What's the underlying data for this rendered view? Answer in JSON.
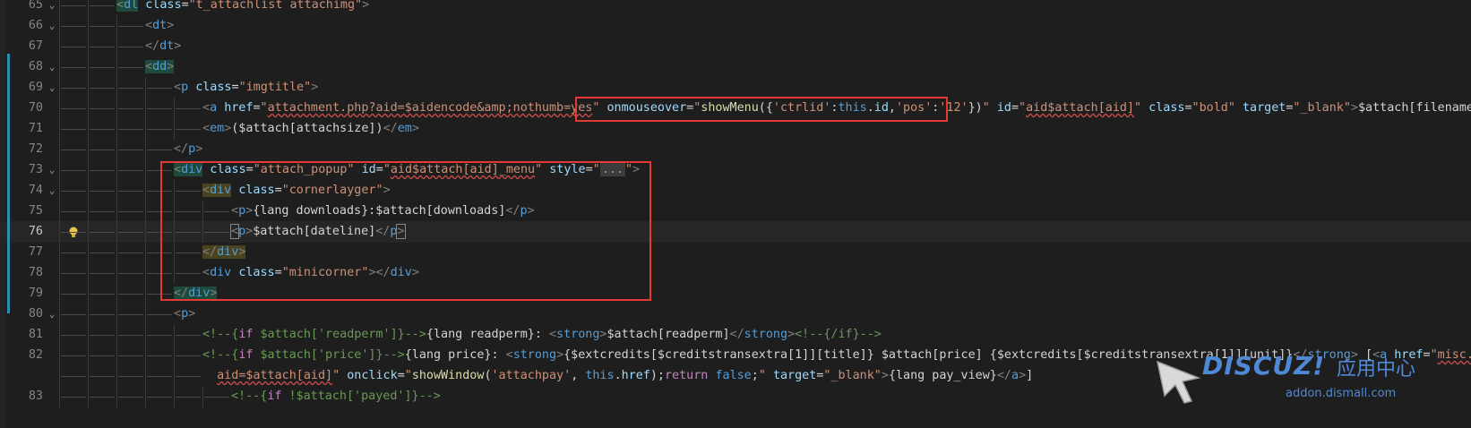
{
  "editor": {
    "lines": [
      {
        "n": "65",
        "fold": "v",
        "indent": 2,
        "html": "<span class='t hl-green'>&lt;</span><span class='tag hl-green'>dl</span> <span class='attr'>class</span><span class='txt'>=</span><span class='str'>\"t_attachlist attachimg\"</span><span class='t'>&gt;</span>"
      },
      {
        "n": "66",
        "fold": "v",
        "indent": 3,
        "html": "<span class='t'>&lt;</span><span class='tag'>dt</span><span class='t'>&gt;</span>"
      },
      {
        "n": "67",
        "fold": "",
        "indent": 3,
        "html": "<span class='t'>&lt;/</span><span class='tag'>dt</span><span class='t'>&gt;</span>"
      },
      {
        "n": "68",
        "fold": "v",
        "indent": 3,
        "html": "<span class='hl-green'><span class='t'>&lt;</span><span class='tag'>dd</span><span class='t'>&gt;</span></span>"
      },
      {
        "n": "69",
        "fold": "v",
        "indent": 4,
        "html": "<span class='t'>&lt;</span><span class='tag'>p</span> <span class='attr'>class</span><span class='txt'>=</span><span class='str'>\"imgtitle\"</span><span class='t'>&gt;</span>"
      },
      {
        "n": "70",
        "fold": "",
        "indent": 5,
        "html": "<span class='t'>&lt;</span><span class='tag'>a</span> <span class='attr'>href</span><span class='txt'>=</span><span class='str'>\"<span class='under'>attachment.php?aid=$aidencode&amp;amp;nothumb=yes</span>\"</span> <span class='attr'>onmouseover</span><span class='txt'>=</span><span class='str'>\"</span><span class='fn'>showMenu</span><span class='txt'>({</span><span class='str'>'ctrlid'</span><span class='txt'>:</span><span class='kw'>this</span><span class='txt'>.</span><span class='attr'>id</span><span class='txt'>,</span><span class='str'>'pos'</span><span class='txt'>:</span><span class='str'>'12'</span><span class='txt'>})</span><span class='str'>\"</span> <span class='attr'>id</span><span class='txt'>=</span><span class='str'>\"<span class='under'>aid$attach[aid]</span>\"</span> <span class='attr'>class</span><span class='txt'>=</span><span class='str'>\"bold\"</span> <span class='attr'>target</span><span class='txt'>=</span><span class='str'>\"_blank\"</span><span class='t'>&gt;</span><span class='txt'>$attach[filename]</span>"
      },
      {
        "n": "71",
        "fold": "",
        "indent": 5,
        "html": "<span class='t'>&lt;</span><span class='tag'>em</span><span class='t'>&gt;</span><span class='txt'>($attach[attachsize])</span><span class='t'>&lt;/</span><span class='tag'>em</span><span class='t'>&gt;</span>"
      },
      {
        "n": "72",
        "fold": "",
        "indent": 4,
        "html": "<span class='t'>&lt;/</span><span class='tag'>p</span><span class='t'>&gt;</span>"
      },
      {
        "n": "73",
        "fold": "v",
        "indent": 4,
        "html": "<span class='hl-green'><span class='t'>&lt;</span><span class='tag'>div</span></span> <span class='attr'>class</span><span class='txt'>=</span><span class='str'>\"attach_popup\"</span> <span class='attr'>id</span><span class='txt'>=</span><span class='str'>\"<span class='under'>aid$attach[aid]_menu</span>\"</span> <span class='attr'>style</span><span class='txt'>=</span><span class='str'>\"</span><span class='dots'>...</span><span class='str'>\"</span><span class='t'>&gt;</span>"
      },
      {
        "n": "74",
        "fold": "v",
        "indent": 5,
        "html": "<span class='hl-yellow'><span class='t'>&lt;</span><span class='tag'>div</span></span> <span class='attr'>class</span><span class='txt'>=</span><span class='str'>\"cornerlayger\"</span><span class='t'>&gt;</span>"
      },
      {
        "n": "75",
        "fold": "",
        "indent": 6,
        "html": "<span class='t'>&lt;</span><span class='tag'>p</span><span class='t'>&gt;</span><span class='txt'>{lang downloads}:$attach[downloads]</span><span class='t'>&lt;/</span><span class='tag'>p</span><span class='t'>&gt;</span>"
      },
      {
        "n": "76",
        "fold": "",
        "indent": 6,
        "current": true,
        "html": "<span class='t' style='outline:1px solid #888'>&lt;</span><span class='tag'>p</span><span class='t'>&gt;</span><span class='txt'>$attach[dateline]</span><span class='t'>&lt;/</span><span class='tag'>p</span><span class='t' style='outline:1px solid #888'>&gt;</span>"
      },
      {
        "n": "77",
        "fold": "",
        "indent": 5,
        "html": "<span class='hl-yellow'><span class='t'>&lt;/</span><span class='tag'>div</span><span class='t'>&gt;</span></span>"
      },
      {
        "n": "78",
        "fold": "",
        "indent": 5,
        "html": "<span class='t'>&lt;</span><span class='tag'>div</span> <span class='attr'>class</span><span class='txt'>=</span><span class='str'>\"minicorner\"</span><span class='t'>&gt;&lt;/</span><span class='tag'>div</span><span class='t'>&gt;</span>"
      },
      {
        "n": "79",
        "fold": "",
        "indent": 4,
        "html": "<span class='hl-green'><span class='t'>&lt;/</span><span class='tag'>div</span><span class='t'>&gt;</span></span>"
      },
      {
        "n": "80",
        "fold": "v",
        "indent": 4,
        "html": "<span class='t'>&lt;</span><span class='tag'>p</span><span class='t'>&gt;</span>"
      },
      {
        "n": "81",
        "fold": "",
        "indent": 5,
        "html": "<span class='cmt'>&lt;!--{</span><span class='ctl'>if</span><span class='cmt'> $attach['readperm']}--&gt;</span><span class='txt'>{lang readperm}: </span><span class='t'>&lt;</span><span class='tag'>strong</span><span class='t'>&gt;</span><span class='txt'>$attach[readperm]</span><span class='t'>&lt;/</span><span class='tag'>strong</span><span class='t'>&gt;</span><span class='cmt'>&lt;!--{/if}--&gt;</span>"
      },
      {
        "n": "82",
        "fold": "",
        "indent": 5,
        "html": "<span class='cmt'>&lt;!--{</span><span class='ctl'>if</span><span class='cmt'> $attach['price']}--&gt;</span><span class='txt'>{lang price}: </span><span class='t'>&lt;</span><span class='tag'>strong</span><span class='t'>&gt;</span><span class='txt'>{$extcredits[$creditstransextra[1]][title]} $attach[price] {$extcredits[$creditstransextra[1]][unit]}</span><span class='t'>&lt;/</span><span class='tag'>strong</span><span class='t'>&gt;</span><span class='txt'> [</span><span class='t'>&lt;</span><span class='tag'>a</span> <span class='attr'>href</span><span class='txt'>=</span><span class='str'>\"<span class='under'>misc.</span>\"</span>"
      },
      {
        "n": "",
        "fold": "",
        "indent": 5,
        "cont": true,
        "html": "<span class='str'><span class='under'>aid=$attach[aid]</span>\"</span> <span class='attr'>onclick</span><span class='txt'>=</span><span class='str'>\"</span><span class='fn'>showWindow</span><span class='txt'>(</span><span class='str'>'attachpay'</span><span class='txt'>, </span><span class='kw'>this</span><span class='txt'>.</span><span class='attr'>href</span><span class='txt'>);</span><span class='ctl'>return</span> <span class='kw'>false</span><span class='txt'>;</span><span class='str'>\"</span> <span class='attr'>target</span><span class='txt'>=</span><span class='str'>\"_blank\"</span><span class='t'>&gt;</span><span class='txt'>{lang pay_view}</span><span class='t'>&lt;/</span><span class='tag'>a</span><span class='t'>&gt;</span><span class='txt'>]</span>"
      },
      {
        "n": "83",
        "fold": "",
        "indent": 6,
        "html": "<span class='cmt'>&lt;!--{</span><span class='ctl'>if</span><span class='cmt'> !$attach['payed']}--&gt;</span>"
      }
    ]
  },
  "watermark": {
    "brand": "DISCUZ!",
    "cn": "应用中心",
    "url": "addon.dismall.com"
  },
  "colors": {
    "background": "#1e1e1e",
    "annotation_box": "#e53935",
    "watermark": "#4f89d6"
  }
}
